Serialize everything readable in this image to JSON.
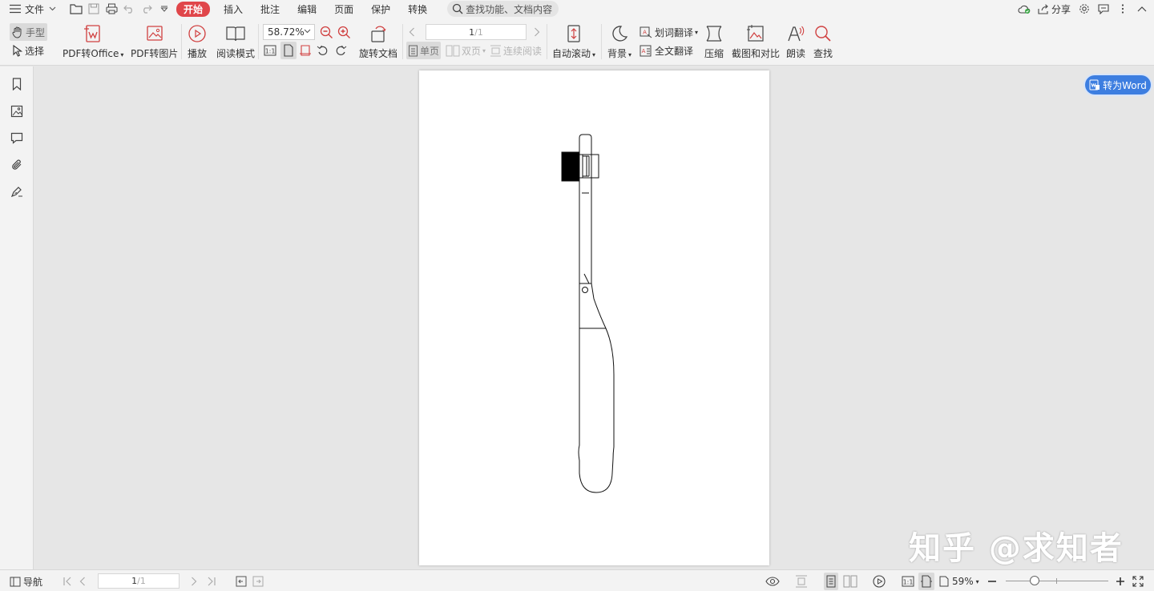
{
  "menubar": {
    "file_label": "文件",
    "tabs": [
      "开始",
      "插入",
      "批注",
      "编辑",
      "页面",
      "保护",
      "转换"
    ],
    "search_placeholder": "查找功能、文档内容",
    "share_label": "分享"
  },
  "ribbon": {
    "hand_label": "手型",
    "select_label": "选择",
    "pdf_to_office": "PDF转Office",
    "pdf_to_image": "PDF转图片",
    "play": "播放",
    "read_mode": "阅读模式",
    "zoom_value": "58.72%",
    "rotate_doc": "旋转文档",
    "page_current": "1",
    "page_total": "/1",
    "single_page": "单页",
    "double_page": "双页",
    "continuous": "连续阅读",
    "auto_scroll": "自动滚动",
    "background": "背景",
    "word_translate": "划词翻译",
    "full_translate": "全文翻译",
    "compress": "压缩",
    "screenshot_compare": "截图和对比",
    "read_aloud": "朗读",
    "find": "查找"
  },
  "to_word_label": "转为Word",
  "watermark": "知乎 @求知者",
  "statusbar": {
    "nav_label": "导航",
    "page_current": "1",
    "page_total": "/1",
    "zoom_percent": "59%"
  },
  "colors": {
    "active_tab": "#e0464a",
    "to_word_button": "#3d7ee0",
    "chrome_bg": "#f3f3f3",
    "workspace_bg": "#e6e6e6"
  }
}
